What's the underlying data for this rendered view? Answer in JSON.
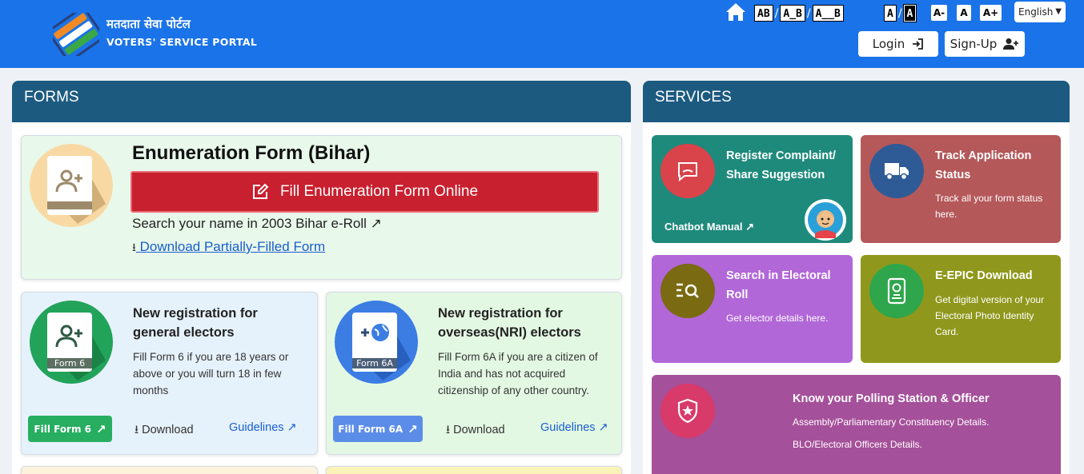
{
  "header": {
    "logo_hindi": "मतदाता सेवा पोर्टल",
    "logo_english": "VOTERS' SERVICE PORTAL",
    "access": {
      "sp1": "AB",
      "sp2": "A_B",
      "sp3": "A__B",
      "c1": "A",
      "c2": "A",
      "fs1": "A-",
      "fs2": "A",
      "fs3": "A+",
      "slash": "/"
    },
    "language": "English",
    "login": "Login",
    "signup": "Sign-Up"
  },
  "forms": {
    "title": "FORMS",
    "enum": {
      "title": "Enumeration Form (Bihar)",
      "button": "Fill Enumeration Form Online",
      "search_link": "Search your name in 2003 Bihar e-Roll",
      "download_link": "Download Partially-Filled Form"
    },
    "form6": {
      "badge": "Form 6",
      "title_line1": "New registration for",
      "title_line2": "general electors",
      "desc_line1": "Fill Form 6 if you are 18 years or",
      "desc_line2": "above or you will turn 18 in few",
      "desc_line3": "months",
      "fill": "Fill Form 6",
      "download": "Download",
      "guidelines": "Guidelines"
    },
    "form6a": {
      "badge": "Form 6A",
      "title_line1": "New registration for",
      "title_line2": "overseas(NRI) electors",
      "desc_line1": "Fill Form 6A if you are a citizen of",
      "desc_line2": "India and has not acquired",
      "desc_line3": "citizenship of any other country.",
      "fill": "Fill Form 6A",
      "download": "Download",
      "guidelines": "Guidelines"
    }
  },
  "services": {
    "title": "SERVICES",
    "complaint": {
      "title_line1": "Register Complaint/",
      "title_line2": "Share Suggestion",
      "link": "Chatbot Manual"
    },
    "track": {
      "title_line1": "Track Application",
      "title_line2": "Status",
      "desc_line1": "Track all your form status",
      "desc_line2": "here."
    },
    "search": {
      "title_line1": "Search in Electoral",
      "title_line2": "Roll",
      "desc": "Get elector details here."
    },
    "epic": {
      "title": "E-EPIC Download",
      "desc_line1": "Get digital version of your",
      "desc_line2": "Electoral Photo Identity",
      "desc_line3": "Card."
    },
    "polling": {
      "title": "Know your Polling Station & Officer",
      "desc_line1": "Assembly/Parliamentary Constituency Details.",
      "desc_line2": "BLO/Electoral Officers Details."
    }
  },
  "colors": {
    "header": "#1a73e8",
    "panel_title": "#1c5a80",
    "enum_button": "#c9202f"
  }
}
